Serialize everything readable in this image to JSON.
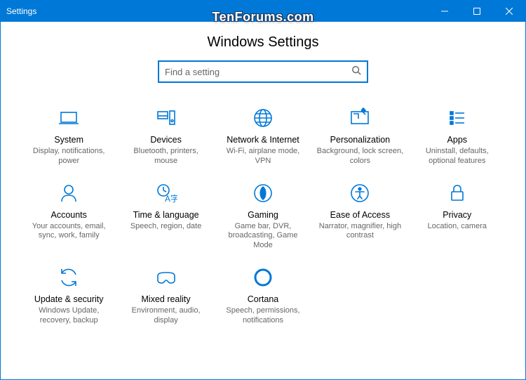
{
  "window": {
    "title": "Settings"
  },
  "watermark": "TenForums.com",
  "page": {
    "heading": "Windows Settings"
  },
  "search": {
    "placeholder": "Find a setting"
  },
  "tiles": [
    {
      "icon": "system-icon",
      "title": "System",
      "desc": "Display, notifications, power"
    },
    {
      "icon": "devices-icon",
      "title": "Devices",
      "desc": "Bluetooth, printers, mouse"
    },
    {
      "icon": "network-icon",
      "title": "Network & Internet",
      "desc": "Wi-Fi, airplane mode, VPN"
    },
    {
      "icon": "personalization-icon",
      "title": "Personalization",
      "desc": "Background, lock screen, colors"
    },
    {
      "icon": "apps-icon",
      "title": "Apps",
      "desc": "Uninstall, defaults, optional features"
    },
    {
      "icon": "accounts-icon",
      "title": "Accounts",
      "desc": "Your accounts, email, sync, work, family"
    },
    {
      "icon": "time-language-icon",
      "title": "Time & language",
      "desc": "Speech, region, date"
    },
    {
      "icon": "gaming-icon",
      "title": "Gaming",
      "desc": "Game bar, DVR, broadcasting, Game Mode"
    },
    {
      "icon": "ease-of-access-icon",
      "title": "Ease of Access",
      "desc": "Narrator, magnifier, high contrast"
    },
    {
      "icon": "privacy-icon",
      "title": "Privacy",
      "desc": "Location, camera"
    },
    {
      "icon": "update-security-icon",
      "title": "Update & security",
      "desc": "Windows Update, recovery, backup"
    },
    {
      "icon": "mixed-reality-icon",
      "title": "Mixed reality",
      "desc": "Environment, audio, display"
    },
    {
      "icon": "cortana-icon",
      "title": "Cortana",
      "desc": "Speech, permissions, notifications"
    }
  ]
}
